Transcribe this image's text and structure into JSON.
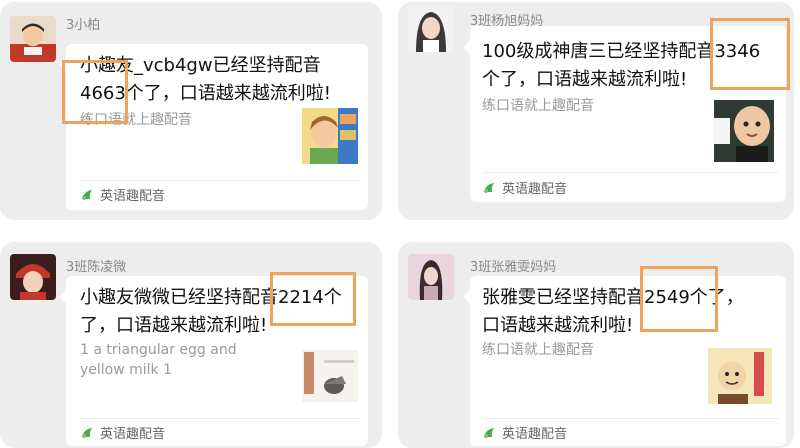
{
  "colors": {
    "highlight": "#f0a35c",
    "panel": "#ededed",
    "card": "#ffffff",
    "source_green": "#3fae4b"
  },
  "posts": [
    {
      "sender": "3小柏",
      "message": "小趣友_vcb4gw已经坚持配音\n4663个了，口语越来越流利啦!",
      "description": "练口语就上趣配音",
      "source": "英语趣配音",
      "source_icon": "dubbing-app-icon",
      "highlighted_count": "4663"
    },
    {
      "sender": "3班杨旭妈妈",
      "message": "100级成神唐三已经坚持配音3346\n个了，口语越来越流利啦!",
      "description": "练口语就上趣配音",
      "source": "英语趣配音",
      "source_icon": "dubbing-app-icon",
      "highlighted_count": "3346"
    },
    {
      "sender": "3班陈凌微",
      "message": "小趣友微微已经坚持配音2214个\n了，口语越来越流利啦!",
      "description": "1 a triangular egg and\nyellow milk 1",
      "source": "英语趣配音",
      "source_icon": "dubbing-app-icon",
      "highlighted_count": "2214"
    },
    {
      "sender": "3班张雅雯妈妈",
      "message": "张雅雯已经坚持配音2549个了，\n口语越来越流利啦!",
      "description": "练口语就上趣配音",
      "source": "英语趣配音",
      "source_icon": "dubbing-app-icon",
      "highlighted_count": "2549"
    }
  ]
}
